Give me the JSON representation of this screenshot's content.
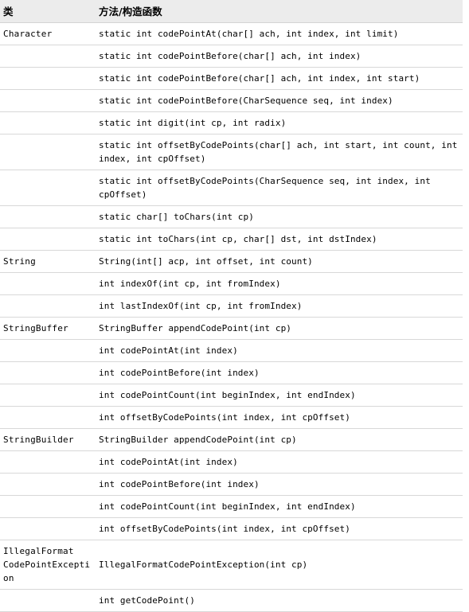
{
  "table": {
    "headers": {
      "class_column": "类",
      "method_column": "方法/构造函数"
    },
    "rows": [
      {
        "cls": "Character",
        "method": "static int codePointAt(char[] ach, int index, int limit)"
      },
      {
        "cls": "",
        "method": "static int codePointBefore(char[] ach, int index)"
      },
      {
        "cls": "",
        "method": "static int codePointBefore(char[] ach, int index, int start)"
      },
      {
        "cls": "",
        "method": "static int codePointBefore(CharSequence seq, int index)"
      },
      {
        "cls": "",
        "method": "static int digit(int cp, int radix)"
      },
      {
        "cls": "",
        "method": "static int offsetByCodePoints(char[] ach, int start, int count, int index, int cpOffset)"
      },
      {
        "cls": "",
        "method": "static int offsetByCodePoints(CharSequence seq, int index, int cpOffset)"
      },
      {
        "cls": "",
        "method": "static char[] toChars(int cp)"
      },
      {
        "cls": "",
        "method": "static int toChars(int cp, char[] dst, int dstIndex)"
      },
      {
        "cls": "String",
        "method": "String(int[] acp, int offset, int count)"
      },
      {
        "cls": "",
        "method": "int indexOf(int cp, int fromIndex)"
      },
      {
        "cls": "",
        "method": "int lastIndexOf(int cp, int fromIndex)"
      },
      {
        "cls": "StringBuffer",
        "method": "StringBuffer appendCodePoint(int cp)"
      },
      {
        "cls": "",
        "method": "int codePointAt(int index)"
      },
      {
        "cls": "",
        "method": "int codePointBefore(int index)"
      },
      {
        "cls": "",
        "method": "int codePointCount(int beginIndex, int endIndex)"
      },
      {
        "cls": "",
        "method": "int offsetByCodePoints(int index, int cpOffset)"
      },
      {
        "cls": "StringBuilder",
        "method": "StringBuilder appendCodePoint(int cp)"
      },
      {
        "cls": "",
        "method": "int codePointAt(int index)"
      },
      {
        "cls": "",
        "method": "int codePointBefore(int index)"
      },
      {
        "cls": "",
        "method": "int codePointCount(int beginIndex, int endIndex)"
      },
      {
        "cls": "",
        "method": "int offsetByCodePoints(int index, int cpOffset)"
      },
      {
        "cls": "IllegalFormat CodePointException",
        "method": "IllegalFormatCodePointException(int cp)"
      },
      {
        "cls": "",
        "method": "int getCodePoint()"
      }
    ]
  },
  "colors": {
    "header_background": "#ececec",
    "row_border": "#d8d8d8",
    "header_border": "#d4d4d4",
    "text": "#000000",
    "page_background": "#ffffff"
  }
}
